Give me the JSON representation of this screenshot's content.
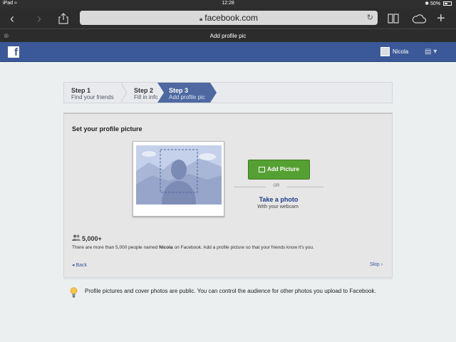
{
  "status_bar": {
    "device": "iPad",
    "time": "12:28",
    "battery": "50%"
  },
  "browser": {
    "url": "facebook.com",
    "page_title": "Add profile pic"
  },
  "fb_header": {
    "logo": "f",
    "user_name": "Nicola"
  },
  "steps": [
    {
      "title": "Step 1",
      "subtitle": "Find your friends"
    },
    {
      "title": "Step 2",
      "subtitle": "Fill in info"
    },
    {
      "title": "Step 3",
      "subtitle": "Add profile pic"
    }
  ],
  "panel": {
    "title": "Set your profile picture",
    "add_picture": "Add Picture",
    "or": "OR",
    "take_photo": "Take a photo",
    "webcam": "With your webcam",
    "people_count": "5,000+",
    "note_before": "There are more than 5,000 people named ",
    "note_name": "Nicola",
    "note_after": " on Facebook. Add a profile picture so that your friends know it's you.",
    "back": "Back",
    "skip": "Skip"
  },
  "info": "Profile pictures and cover photos are public. You can control the audience for other photos you upload to Facebook.",
  "colors": {
    "fb_blue": "#3b5998",
    "active_step": "#4e69a2",
    "green_button": "#55a032"
  },
  "icons": [
    "back-arrow-icon",
    "forward-arrow-icon",
    "share-icon",
    "lock-icon",
    "reload-icon",
    "bookmarks-icon",
    "cloud-icon",
    "new-tab-icon",
    "close-icon",
    "settings-icon",
    "people-icon",
    "lightbulb-icon"
  ]
}
